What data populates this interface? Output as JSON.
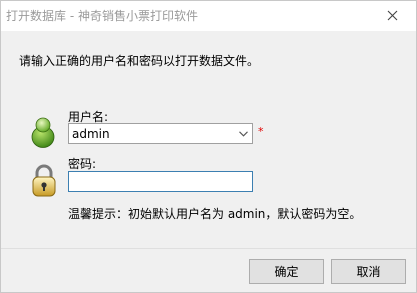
{
  "window": {
    "title": "打开数据库 - 神奇销售小票打印软件"
  },
  "instruction": "请输入正确的用户名和密码以打开数据文件。",
  "username": {
    "label": "用户名:",
    "value": "admin",
    "required_mark": "*"
  },
  "password": {
    "label": "密码:",
    "value": ""
  },
  "hint": "温馨提示：初始默认用户名为 admin，默认密码为空。",
  "buttons": {
    "ok": "确定",
    "cancel": "取消"
  },
  "icons": {
    "close": "close-icon",
    "user": "user-icon",
    "lock": "lock-icon",
    "dropdown": "chevron-down-icon"
  }
}
